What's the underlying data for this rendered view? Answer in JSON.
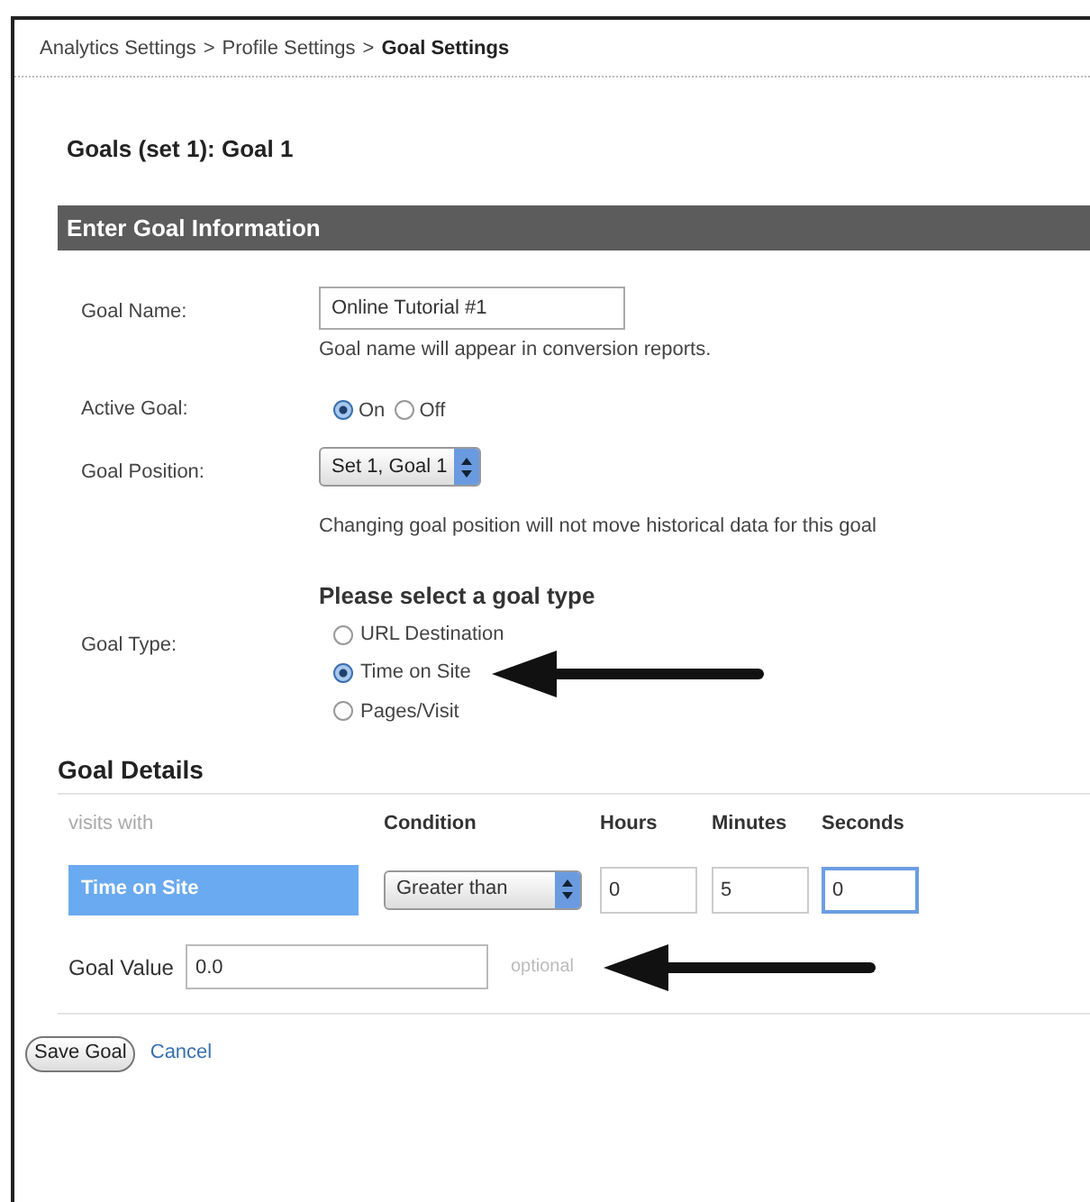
{
  "breadcrumb": [
    {
      "label": "Analytics Settings",
      "current": false
    },
    {
      "label": "Profile Settings",
      "current": false
    },
    {
      "label": "Goal Settings",
      "current": true
    }
  ],
  "breadcrumb_separator": ">",
  "page_title": "Goals (set 1): Goal 1",
  "section_header": "Enter Goal Information",
  "goal_name": {
    "label": "Goal Name:",
    "value": "Online Tutorial #1",
    "hint": "Goal name will appear in conversion reports."
  },
  "active_goal": {
    "label": "Active Goal:",
    "options": [
      {
        "label": "On",
        "selected": true
      },
      {
        "label": "Off",
        "selected": false
      }
    ]
  },
  "goal_position": {
    "label": "Goal Position:",
    "value": "Set 1, Goal 1",
    "hint": "Changing goal position will not move historical data for this goal"
  },
  "goal_type": {
    "heading": "Please select a goal type",
    "label": "Goal Type:",
    "options": [
      {
        "label": "URL Destination",
        "selected": false,
        "arrow": false
      },
      {
        "label": "Time on Site",
        "selected": true,
        "arrow": true
      },
      {
        "label": "Pages/Visit",
        "selected": false,
        "arrow": false
      }
    ]
  },
  "goal_details": {
    "heading": "Goal Details",
    "columns": [
      "visits with",
      "Condition",
      "Hours",
      "Minutes",
      "Seconds"
    ],
    "metric": "Time on Site",
    "condition": "Greater than",
    "time_fields": [
      {
        "value": "0",
        "focused": false
      },
      {
        "value": "5",
        "focused": false
      },
      {
        "value": "0",
        "focused": true
      }
    ]
  },
  "goal_value": {
    "label": "Goal Value",
    "value": "0.0",
    "note": "optional",
    "arrow": true
  },
  "buttons": {
    "save": "Save Goal",
    "cancel": "Cancel"
  }
}
